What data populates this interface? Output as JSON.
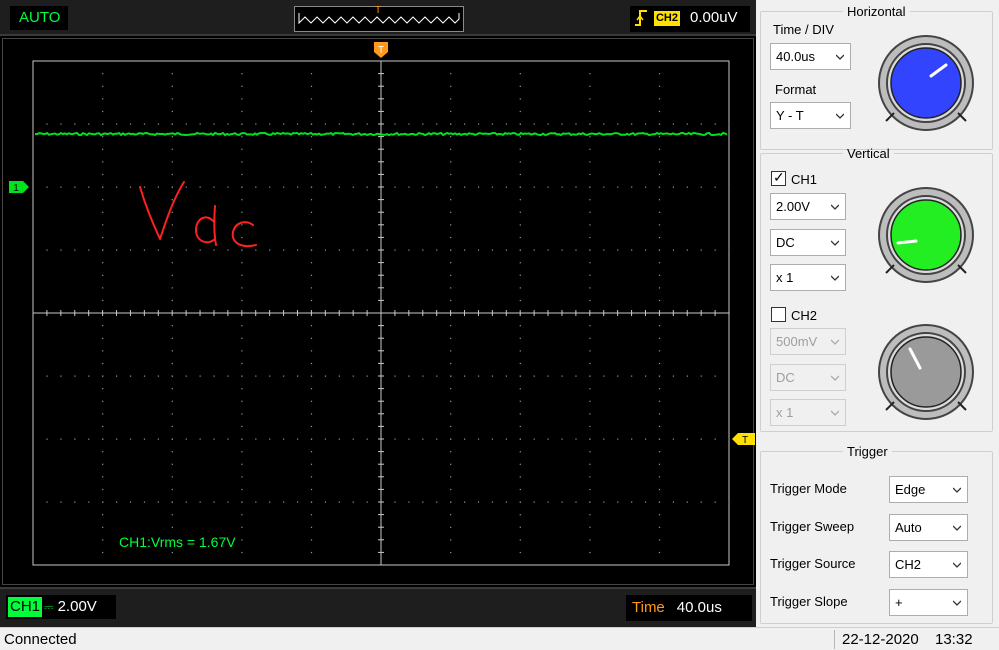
{
  "topbar": {
    "acquire_mode": "AUTO",
    "trigger_marker": "T",
    "trigger_channel": "CH2",
    "trigger_level": "0.00uV"
  },
  "screen": {
    "trigger_pos_marker": "T",
    "ch1_marker": "1",
    "measurement": "CH1:Vrms = 1.67V",
    "annotation": "Vdc",
    "trace_color": "#00e21c",
    "grid": {
      "cols": 10,
      "rows": 8
    }
  },
  "bottombar": {
    "ch1_tag": "CH1",
    "ch1_coupling_glyph": "⎓",
    "ch1_scale": "2.00V",
    "time_label": "Time",
    "time_value": "40.0us"
  },
  "horizontal": {
    "title": "Horizontal",
    "timediv_label": "Time / DIV",
    "timediv_value": "40.0us",
    "format_label": "Format",
    "format_value": "Y - T",
    "knob_color": "#3344ff"
  },
  "vertical": {
    "title": "Vertical",
    "ch1": {
      "label": "CH1",
      "checked": true,
      "scale": "2.00V",
      "coupling": "DC",
      "probe": "x 1",
      "knob_color": "#22ee22"
    },
    "ch2": {
      "label": "CH2",
      "checked": false,
      "scale": "500mV",
      "coupling": "DC",
      "probe": "x 1",
      "knob_color": "#9a9a9a"
    }
  },
  "trigger": {
    "title": "Trigger",
    "mode_label": "Trigger Mode",
    "mode_value": "Edge",
    "sweep_label": "Trigger Sweep",
    "sweep_value": "Auto",
    "source_label": "Trigger Source",
    "source_value": "CH2",
    "slope_label": "Trigger Slope",
    "slope_value": "+"
  },
  "statusbar": {
    "connection": "Connected",
    "date": "22-12-2020",
    "time": "13:32"
  }
}
